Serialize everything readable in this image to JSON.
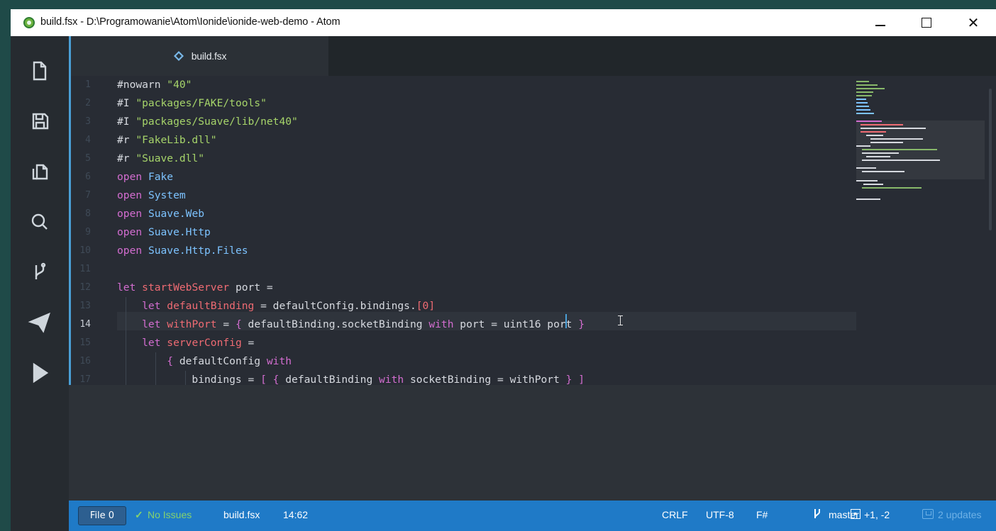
{
  "window": {
    "title": "build.fsx - D:\\Programowanie\\Atom\\Ionide\\ionide-web-demo - Atom",
    "app_icon": "atom-icon"
  },
  "toolbar": {
    "items": [
      {
        "icon": "file-icon"
      },
      {
        "icon": "save-icon"
      },
      {
        "icon": "copy-icon"
      },
      {
        "icon": "search-icon"
      },
      {
        "icon": "git-branch-icon"
      },
      {
        "icon": "send-icon"
      },
      {
        "icon": "play-icon"
      }
    ]
  },
  "tab": {
    "label": "build.fsx",
    "icon": "fsharp-file-icon"
  },
  "editor": {
    "active_line": 14,
    "lines": [
      {
        "no": "1",
        "tokens": [
          {
            "t": "#nowarn ",
            "c": "plain"
          },
          {
            "t": "\"40\"",
            "c": "str"
          }
        ]
      },
      {
        "no": "2",
        "tokens": [
          {
            "t": "#I ",
            "c": "plain"
          },
          {
            "t": "\"packages/FAKE/tools\"",
            "c": "str"
          }
        ]
      },
      {
        "no": "3",
        "tokens": [
          {
            "t": "#I ",
            "c": "plain"
          },
          {
            "t": "\"packages/Suave/lib/net40\"",
            "c": "str"
          }
        ]
      },
      {
        "no": "4",
        "tokens": [
          {
            "t": "#r ",
            "c": "plain"
          },
          {
            "t": "\"FakeLib.dll\"",
            "c": "str"
          }
        ]
      },
      {
        "no": "5",
        "tokens": [
          {
            "t": "#r ",
            "c": "plain"
          },
          {
            "t": "\"Suave.dll\"",
            "c": "str"
          }
        ]
      },
      {
        "no": "6",
        "tokens": [
          {
            "t": "open ",
            "c": "kw"
          },
          {
            "t": "Fake",
            "c": "id"
          }
        ]
      },
      {
        "no": "7",
        "tokens": [
          {
            "t": "open ",
            "c": "kw"
          },
          {
            "t": "System",
            "c": "id"
          }
        ]
      },
      {
        "no": "8",
        "tokens": [
          {
            "t": "open ",
            "c": "kw"
          },
          {
            "t": "Suave.Web",
            "c": "id"
          }
        ]
      },
      {
        "no": "9",
        "tokens": [
          {
            "t": "open ",
            "c": "kw"
          },
          {
            "t": "Suave.Http",
            "c": "id"
          }
        ]
      },
      {
        "no": "10",
        "tokens": [
          {
            "t": "open ",
            "c": "kw"
          },
          {
            "t": "Suave.Http.Files",
            "c": "id"
          }
        ]
      },
      {
        "no": "11",
        "tokens": []
      },
      {
        "no": "12",
        "tokens": [
          {
            "t": "let ",
            "c": "kw"
          },
          {
            "t": "startWebServer",
            "c": "fn"
          },
          {
            "t": " port =",
            "c": "plain"
          }
        ]
      },
      {
        "no": "13",
        "tokens": [
          {
            "t": "    let ",
            "c": "kw"
          },
          {
            "t": "defaultBinding",
            "c": "fn"
          },
          {
            "t": " = defaultConfig.bindings.",
            "c": "plain"
          },
          {
            "t": "[0]",
            "c": "fn"
          }
        ]
      },
      {
        "no": "14",
        "tokens": [
          {
            "t": "    let ",
            "c": "kw"
          },
          {
            "t": "withPort",
            "c": "fn"
          },
          {
            "t": " = ",
            "c": "plain"
          },
          {
            "t": "{",
            "c": "kw"
          },
          {
            "t": " defaultBinding.socketBinding ",
            "c": "plain"
          },
          {
            "t": "with",
            "c": "kw"
          },
          {
            "t": " port = uint16 port ",
            "c": "plain"
          },
          {
            "t": "}",
            "c": "kw"
          }
        ]
      },
      {
        "no": "15",
        "tokens": [
          {
            "t": "    let ",
            "c": "kw"
          },
          {
            "t": "serverConfig",
            "c": "fn"
          },
          {
            "t": " =",
            "c": "plain"
          }
        ]
      },
      {
        "no": "16",
        "tokens": [
          {
            "t": "        { ",
            "c": "kw"
          },
          {
            "t": "defaultConfig ",
            "c": "plain"
          },
          {
            "t": "with",
            "c": "kw"
          }
        ]
      },
      {
        "no": "17",
        "tokens": [
          {
            "t": "            bindings = ",
            "c": "plain"
          },
          {
            "t": "[ { ",
            "c": "kw"
          },
          {
            "t": "defaultBinding ",
            "c": "plain"
          },
          {
            "t": "with",
            "c": "kw"
          },
          {
            "t": " socketBinding = withPort ",
            "c": "plain"
          },
          {
            "t": "} ]",
            "c": "kw"
          }
        ]
      }
    ]
  },
  "statusbar": {
    "file_button": "File 0",
    "issues": "No Issues",
    "filename": "build.fsx",
    "position": "14:62",
    "line_ending": "CRLF",
    "encoding": "UTF-8",
    "grammar": "F#",
    "branch": "master",
    "diff": "+1, -2",
    "updates": "2 updates"
  },
  "colors": {
    "accent": "#1f7ac7",
    "keyword": "#d36dd0",
    "string": "#a6d46a",
    "identifier": "#7dc3ff",
    "function": "#ef6b73"
  }
}
